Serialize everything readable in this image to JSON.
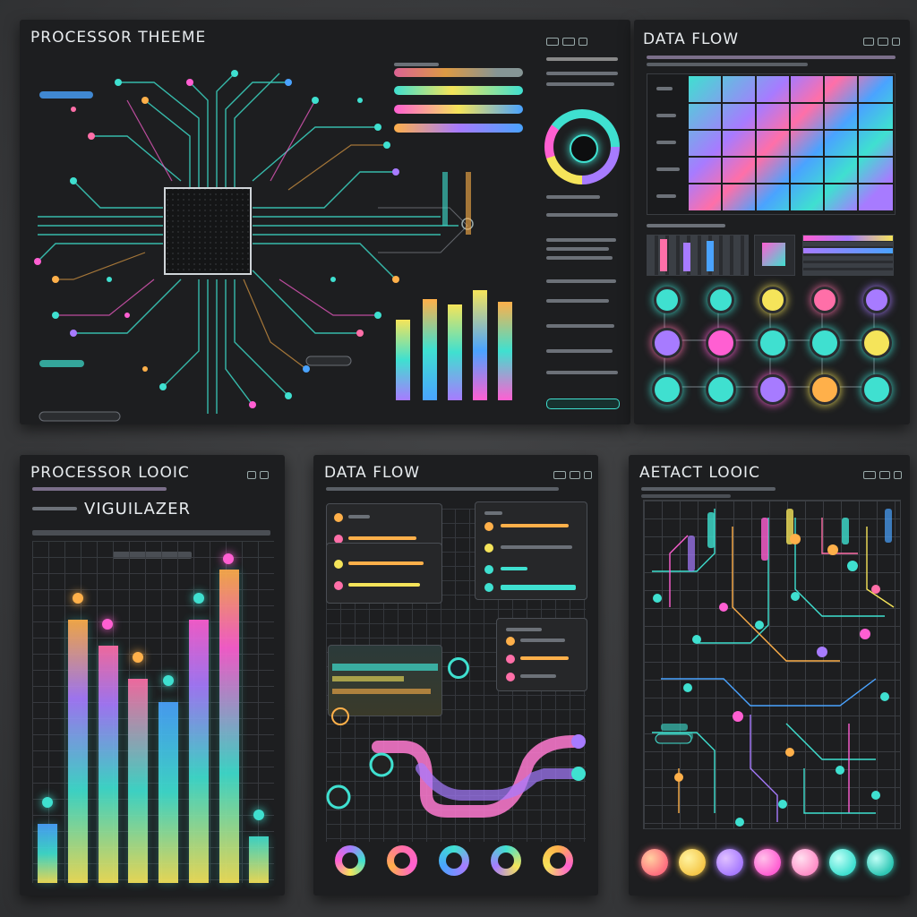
{
  "panels": {
    "processor_theme": {
      "title": "PROCESSOR THEEME"
    },
    "data_flow_top": {
      "title": "DATA FLOW"
    },
    "processor_logic": {
      "title": "PROCESSOR LOOIC",
      "subtitle": "VIGUILAZER"
    },
    "data_flow_bottom": {
      "title": "DATA FLOW"
    },
    "abstract_logic": {
      "title": "AETACT LOOIC"
    }
  },
  "colors": {
    "panel_bg": "#1d1e20",
    "cyan": "#3fe0d0",
    "teal": "#2ec7b5",
    "magenta": "#ff5fd2",
    "pink": "#ff6fa8",
    "orange": "#ffb04a",
    "yellow": "#f5e45a",
    "violet": "#a77bff",
    "blue": "#4aa3ff"
  },
  "icons": [
    "chip-icon",
    "gauge-icon",
    "close-icon",
    "minimize-icon",
    "maximize-icon"
  ],
  "bar_levels": [
    0.62,
    0.78,
    0.74,
    0.85,
    0.76
  ],
  "visualizer_levels": [
    0.18,
    0.8,
    0.72,
    0.62,
    0.55,
    0.8,
    0.95,
    0.14
  ]
}
